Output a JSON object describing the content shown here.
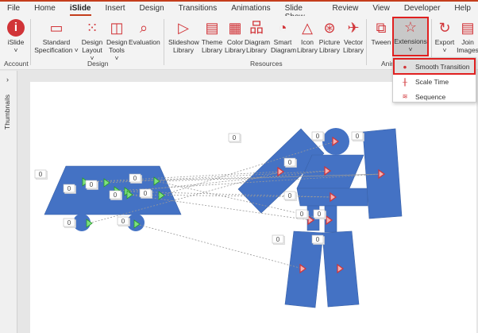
{
  "tabs": [
    "File",
    "Home",
    "iSlide",
    "Insert",
    "Design",
    "Transitions",
    "Animations",
    "Slide Show",
    "Review",
    "View",
    "Developer",
    "Help"
  ],
  "active_tab": "iSlide",
  "ribbon": {
    "islide": {
      "label": "iSlide",
      "group": "Account"
    },
    "design": {
      "group": "Design",
      "buttons": [
        "Standard",
        "Specification ˅",
        "Design",
        "Layout ˅",
        "Design",
        "Tools ˅",
        "Evaluation"
      ]
    },
    "resources": {
      "group": "Resources",
      "buttons": [
        [
          "Slideshow",
          "Library"
        ],
        [
          "Theme",
          "Library"
        ],
        [
          "Color",
          "Library"
        ],
        [
          "Diagram",
          "Library"
        ],
        [
          "Smart",
          "Diagram"
        ],
        [
          "Icon",
          "Library"
        ],
        [
          "Picture",
          "Library"
        ],
        [
          "Vector",
          "Library"
        ]
      ]
    },
    "animation": {
      "group": "Anim",
      "tween": "Tween",
      "extensions": "Extensions"
    },
    "export": {
      "label": "Export"
    },
    "join": {
      "label1": "Join",
      "label2": "Images"
    }
  },
  "menu": {
    "items": [
      "Smooth Transition",
      "Scale Time",
      "Sequence"
    ],
    "selected": "Smooth Transition"
  },
  "thumbnails": {
    "label": "Thumbnails"
  },
  "slide": {
    "badge": "0",
    "shape_color": "#4472c4",
    "accent": "#d13438"
  }
}
